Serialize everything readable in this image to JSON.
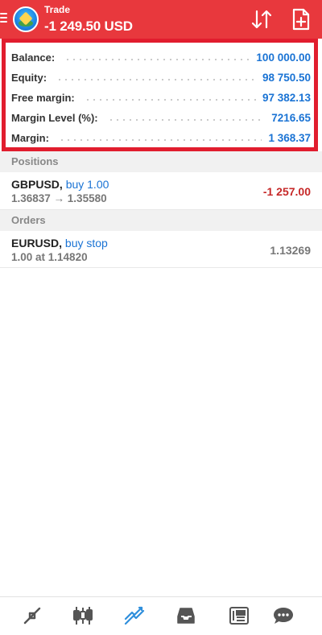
{
  "header": {
    "title": "Trade",
    "profit": "-1 249.50 USD"
  },
  "summary": {
    "rows": [
      {
        "label": "Balance:",
        "value": "100 000.00"
      },
      {
        "label": "Equity:",
        "value": "98 750.50"
      },
      {
        "label": "Free margin:",
        "value": "97 382.13"
      },
      {
        "label": "Margin Level (%):",
        "value": "7216.65"
      },
      {
        "label": "Margin:",
        "value": "1 368.37"
      }
    ]
  },
  "positions": {
    "section_label": "Positions",
    "items": [
      {
        "symbol": "GBPUSD,",
        "action": "buy 1.00",
        "detail": "1.36837 → 1.35580",
        "amount": "-1 257.00",
        "amount_color": "#c62828"
      }
    ]
  },
  "orders": {
    "section_label": "Orders",
    "items": [
      {
        "symbol": "EURUSD,",
        "action": "buy stop",
        "detail": "1.00 at 1.14820",
        "amount": "1.13269",
        "amount_color": "#777777"
      }
    ]
  },
  "bottom_nav": {
    "tabs": [
      {
        "icon": "quotes-icon",
        "active": false
      },
      {
        "icon": "chart-icon",
        "active": false
      },
      {
        "icon": "trade-icon",
        "active": true
      },
      {
        "icon": "history-icon",
        "active": false
      },
      {
        "icon": "news-icon",
        "active": false
      },
      {
        "icon": "chat-icon",
        "active": false
      }
    ]
  },
  "colors": {
    "header_bg": "#e8383d",
    "highlight_border": "#e11d2e",
    "value_blue": "#1a73d4",
    "loss_red": "#c62828",
    "active_tab": "#2f8fdc",
    "inactive_tab": "#555555"
  }
}
